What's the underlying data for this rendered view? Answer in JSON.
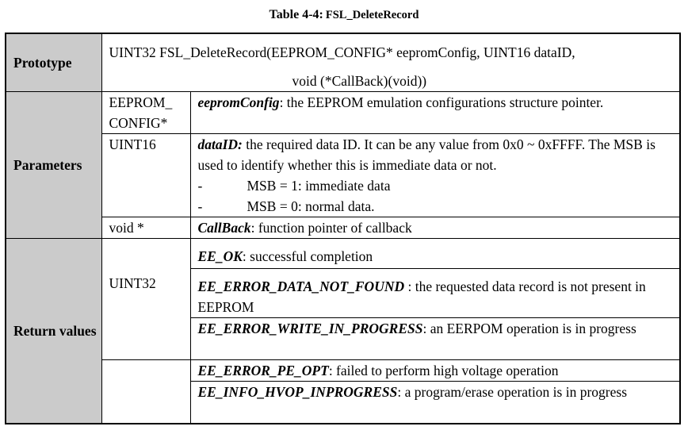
{
  "caption": {
    "prefix": "Table 4-4:",
    "name": "FSL_DeleteRecord"
  },
  "prototype": {
    "label": "Prototype",
    "line1": "UINT32 FSL_DeleteRecord(EEPROM_CONFIG* eepromConfig, UINT16 dataID,",
    "line2": "void (*CallBack)(void))"
  },
  "parameters": {
    "label": "Parameters",
    "rows": [
      {
        "type": "EEPROM_ CONFIG*",
        "name": "eepromConfig",
        "desc": ": the EEPROM emulation configurations structure pointer."
      },
      {
        "type": "UINT16",
        "name": "dataID:",
        "desc": " the required data ID. It can be any value from 0x0 ~ 0xFFFF. The MSB is used to identify whether this is immediate data or not.",
        "bullets": [
          {
            "dash": "-",
            "text": "MSB = 1: immediate data"
          },
          {
            "dash": "-",
            "text": "MSB = 0: normal data."
          }
        ]
      },
      {
        "type": "void *",
        "name": "CallBack",
        "desc": ": function pointer of callback"
      }
    ]
  },
  "returns": {
    "label": "Return values",
    "type": "UINT32",
    "rows": [
      {
        "name": "EE_OK",
        "desc": ": successful completion"
      },
      {
        "name": "EE_ERROR_DATA_NOT_FOUND",
        "desc": " : the requested data record is not present in EEPROM"
      },
      {
        "name": "EE_ERROR_WRITE_IN_PROGRESS",
        "desc": ": an EERPOM operation is in progress"
      },
      {
        "name": "EE_ERROR_PE_OPT",
        "desc": ": failed to perform high voltage operation"
      },
      {
        "name": "EE_INFO_HVOP_INPROGRESS",
        "desc": ": a program/erase operation is in progress"
      }
    ]
  }
}
